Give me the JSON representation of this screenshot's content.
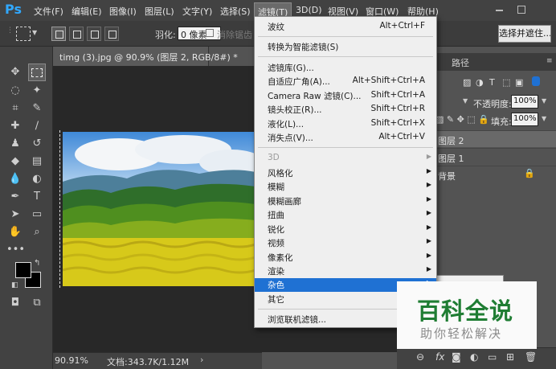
{
  "app": {
    "logo": "Ps"
  },
  "menubar": {
    "items": [
      "文件(F)",
      "编辑(E)",
      "图像(I)",
      "图层(L)",
      "文字(Y)",
      "选择(S)",
      "滤镜(T)",
      "3D(D)",
      "视图(V)",
      "窗口(W)",
      "帮助(H)"
    ],
    "active": "滤镜(T)"
  },
  "options": {
    "feather_label": "羽化:",
    "feather_value": "0 像素",
    "antialias_label": "消除锯齿",
    "select_mask_button": "选择并遮住..."
  },
  "document": {
    "tab_title": "timg (3).jpg @ 90.9% (图层 2, RGB/8#) *",
    "zoom": "90.91%",
    "info": "文档:343.7K/1.12M"
  },
  "filter_menu": {
    "groups": [
      [
        {
          "label": "波纹",
          "shortcut": "Alt+Ctrl+F"
        }
      ],
      [
        {
          "label": "转换为智能滤镜(S)",
          "shortcut": ""
        }
      ],
      [
        {
          "label": "滤镜库(G)...",
          "shortcut": ""
        },
        {
          "label": "自适应广角(A)...",
          "shortcut": "Alt+Shift+Ctrl+A"
        },
        {
          "label": "Camera Raw 滤镜(C)...",
          "shortcut": "Shift+Ctrl+A"
        },
        {
          "label": "镜头校正(R)...",
          "shortcut": "Shift+Ctrl+R"
        },
        {
          "label": "液化(L)...",
          "shortcut": "Shift+Ctrl+X"
        },
        {
          "label": "消失点(V)...",
          "shortcut": "Alt+Ctrl+V"
        }
      ],
      [
        {
          "label": "3D",
          "submenu": true,
          "disabled": true
        },
        {
          "label": "风格化",
          "submenu": true
        },
        {
          "label": "模糊",
          "submenu": true
        },
        {
          "label": "模糊画廊",
          "submenu": true
        },
        {
          "label": "扭曲",
          "submenu": true
        },
        {
          "label": "锐化",
          "submenu": true
        },
        {
          "label": "视频",
          "submenu": true
        },
        {
          "label": "像素化",
          "submenu": true
        },
        {
          "label": "渲染",
          "submenu": true
        },
        {
          "label": "杂色",
          "submenu": true,
          "highlighted": true
        },
        {
          "label": "其它",
          "submenu": true
        }
      ],
      [
        {
          "label": "浏览联机滤镜...",
          "shortcut": ""
        }
      ]
    ]
  },
  "layers_panel": {
    "tab_paths": "路径",
    "opacity_label": "不透明度:",
    "opacity_value": "100%",
    "fill_label": "填充:",
    "fill_value": "100%",
    "layers": [
      {
        "name": "图层 2",
        "selected": true
      },
      {
        "name": "图层 1",
        "selected": false
      },
      {
        "name": "背景",
        "selected": false,
        "locked": true
      }
    ]
  },
  "watermark": {
    "title": "百科全说",
    "subtitle": "助你轻松解决"
  },
  "colors": {
    "menu_highlight": "#1f71d3",
    "ps_blue": "#31a8ff",
    "watermark_green": "#1f7d33"
  }
}
